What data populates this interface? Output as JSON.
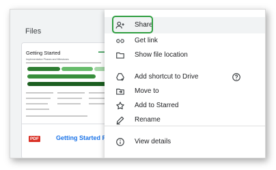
{
  "files_panel": {
    "title": "Files",
    "card": {
      "doc_title": "Getting Started",
      "doc_subtitle": "Implementation Phases and Milestones",
      "file_type": "PDF",
      "file_name": "Getting Started Form ..."
    }
  },
  "menu": {
    "items": [
      {
        "label": "Share",
        "icon": "person-add-icon"
      },
      {
        "label": "Get link",
        "icon": "link-icon"
      },
      {
        "label": "Show file location",
        "icon": "folder-icon"
      },
      {
        "label": "Add shortcut to Drive",
        "icon": "drive-shortcut-icon"
      },
      {
        "label": "Move to",
        "icon": "move-to-icon"
      },
      {
        "label": "Add to Starred",
        "icon": "star-icon"
      },
      {
        "label": "Rename",
        "icon": "pencil-icon"
      },
      {
        "label": "View details",
        "icon": "info-icon"
      }
    ],
    "help_icon": "help-icon"
  },
  "colors": {
    "highlight_border": "#2e9e3f",
    "link_text": "#1a73e8",
    "pdf_badge": "#d93025"
  }
}
